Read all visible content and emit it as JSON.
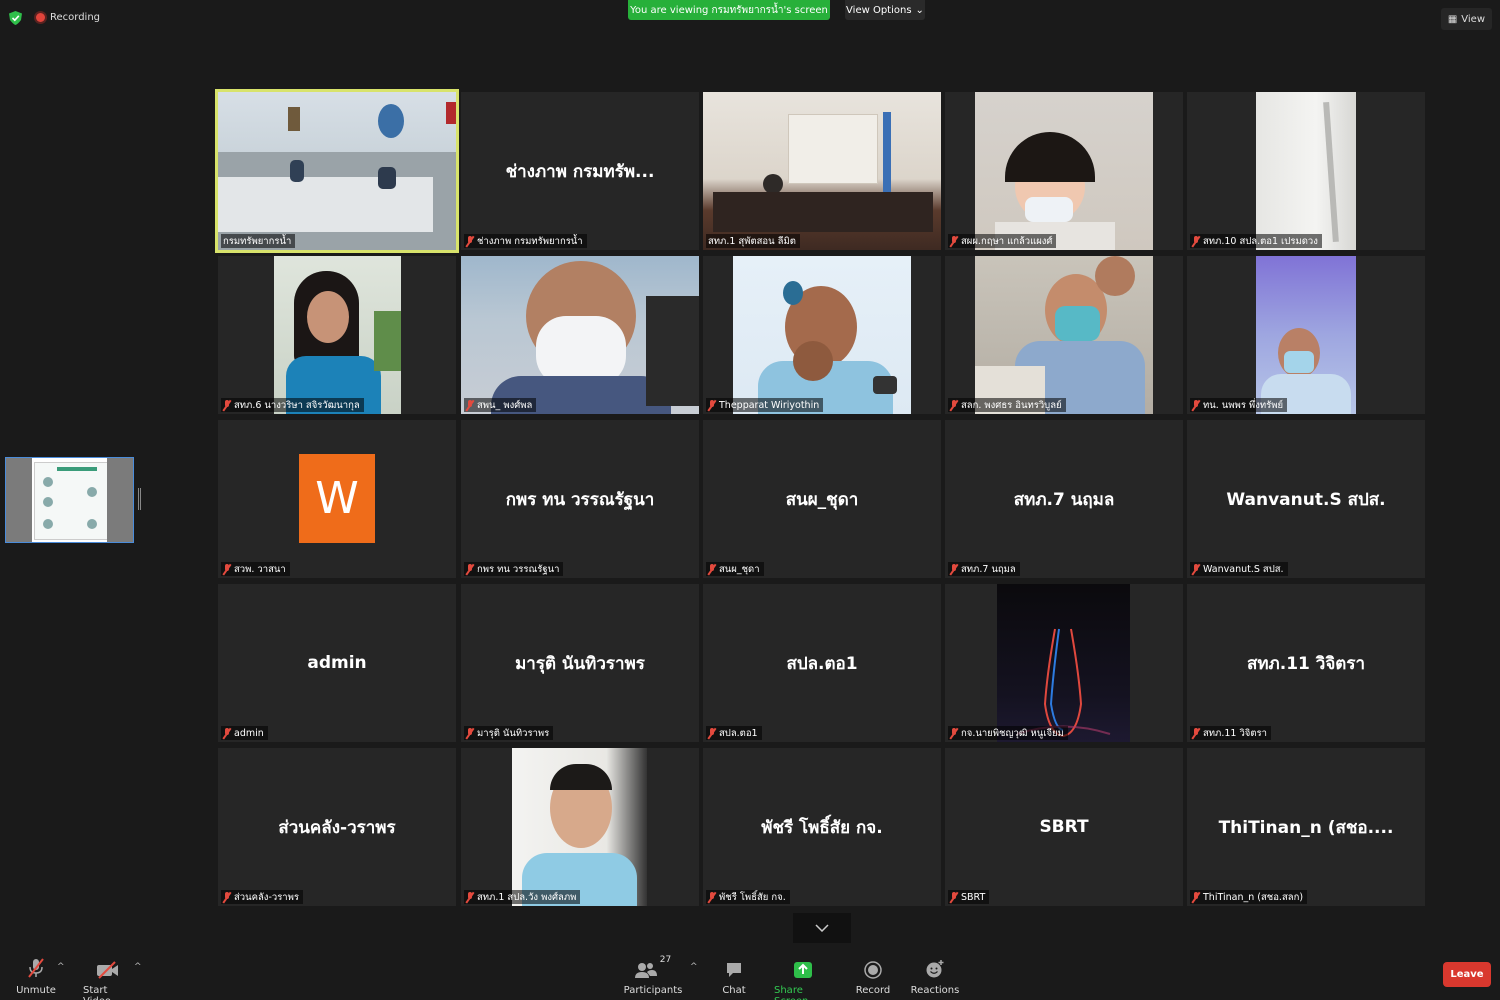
{
  "top": {
    "recording_label": "Recording",
    "viewing_banner": "You are viewing กรมทรัพยากรน้ำ's screen",
    "view_options_label": "View Options",
    "view_button_label": "View"
  },
  "tiles": [
    {
      "big": "",
      "label": "กรมทรัพยากรน้ำ",
      "muted": false,
      "active": true
    },
    {
      "big": "ช่างภาพ กรมทรัพ...",
      "label": "ช่างภาพ กรมทรัพยากรน้ำ",
      "muted": true
    },
    {
      "big": "",
      "label": "สทภ.1 สุพัตสอน ลีมิต",
      "muted": false
    },
    {
      "big": "",
      "label": "สผผ.กฤษา แกล้วแผงศ์",
      "muted": true
    },
    {
      "big": "",
      "label": "สทภ.10 สปล.ตอ1 เปรมดวง",
      "muted": true
    },
    {
      "big": "",
      "label": "สทภ.6 นางวริษา สจิรวัฒนากุล",
      "muted": true
    },
    {
      "big": "",
      "label": "สพน_ พงศ์พล",
      "muted": true
    },
    {
      "big": "",
      "label": "Thepparat Wiriyothin",
      "muted": true
    },
    {
      "big": "",
      "label": "สลก. พงศธร อินทรวิบูลย์",
      "muted": true
    },
    {
      "big": "",
      "label": "ทน. นพพร พึ่งทรัพย์",
      "muted": true
    },
    {
      "big": "",
      "label": "สวพ. วาสนา",
      "muted": true,
      "avatar_letter": "W"
    },
    {
      "big": "กพร ทน วรรณรัฐนา",
      "label": "กพร ทน วรรณรัฐนา",
      "muted": true
    },
    {
      "big": "สนผ_ชุดา",
      "label": "สนผ_ชุดา",
      "muted": true
    },
    {
      "big": "สทภ.7 นฤมล",
      "label": "สทภ.7 นฤมล",
      "muted": true
    },
    {
      "big": "Wanvanut.S สปส.",
      "label": "Wanvanut.S สปส.",
      "muted": true
    },
    {
      "big": "admin",
      "label": "admin",
      "muted": true
    },
    {
      "big": "มารุติ นันทิวราพร",
      "label": "มารุติ นันทิวราพร",
      "muted": true
    },
    {
      "big": "สปล.ตอ1",
      "label": "สปล.ตอ1",
      "muted": true
    },
    {
      "big": "",
      "label": "กจ.นายพิชญวุฒิ หนูเจียม",
      "muted": true
    },
    {
      "big": "สทภ.11 วิจิตรา",
      "label": "สทภ.11 วิจิตรา",
      "muted": true
    },
    {
      "big": "ส่วนคลัง-วราพร",
      "label": "ส่วนคลัง-วราพร",
      "muted": true
    },
    {
      "big": "",
      "label": "สทภ.1 สปล.วัง พงศ์ลภพ",
      "muted": true
    },
    {
      "big": "พัชรี โพธิ์สัย กจ.",
      "label": "พัชรี โพธิ์สัย กจ.",
      "muted": true
    },
    {
      "big": "SBRT",
      "label": "SBRT",
      "muted": true
    },
    {
      "big": "ThiTinan_n (สชอ....",
      "label": "ThiTinan_n (สชอ.สลก)",
      "muted": true
    }
  ],
  "toolbar": {
    "unmute": "Unmute",
    "start_video": "Start Video",
    "participants": "Participants",
    "participant_count": "27",
    "chat": "Chat",
    "share_screen": "Share Screen",
    "record": "Record",
    "reactions": "Reactions",
    "leave": "Leave"
  },
  "colors": {
    "accent_green": "#27b03a",
    "leave_red": "#d9382e",
    "active_speaker": "#d8e36b"
  }
}
